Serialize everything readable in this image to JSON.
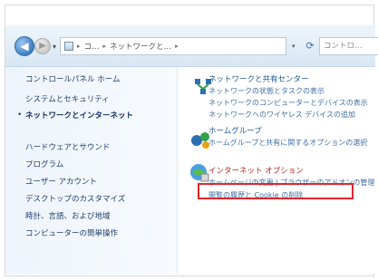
{
  "toolbar": {
    "address_segments": [
      "コ…",
      "ネットワークと…"
    ],
    "search_placeholder": "コントロ…"
  },
  "sidebar": {
    "items": [
      {
        "label": "コントロールパネル ホーム"
      },
      {
        "label": "システムとセキュリティ"
      },
      {
        "label": "ネットワークとインターネット"
      },
      {
        "label": "ハードウェアとサウンド"
      },
      {
        "label": "プログラム"
      },
      {
        "label": "ユーザー アカウント"
      },
      {
        "label": "デスクトップのカスタマイズ"
      },
      {
        "label": "時計、言語、および地域"
      },
      {
        "label": "コンピューターの簡単操作"
      }
    ]
  },
  "categories": [
    {
      "title": "ネットワークと共有センター",
      "links": [
        "ネットワークの状態とタスクの表示",
        "ネットワークのコンピューターとデバイスの表示",
        "ネットワークへのワイヤレス デバイスの追加"
      ]
    },
    {
      "title": "ホームグループ",
      "links": [
        "ホームグループと共有に関するオプションの選択"
      ]
    },
    {
      "title": "インターネット オプション",
      "links": [
        "ホームページの変更 | ブラウザーのアドオンの管理",
        "閲覧の履歴と Cookie の削除"
      ]
    }
  ]
}
